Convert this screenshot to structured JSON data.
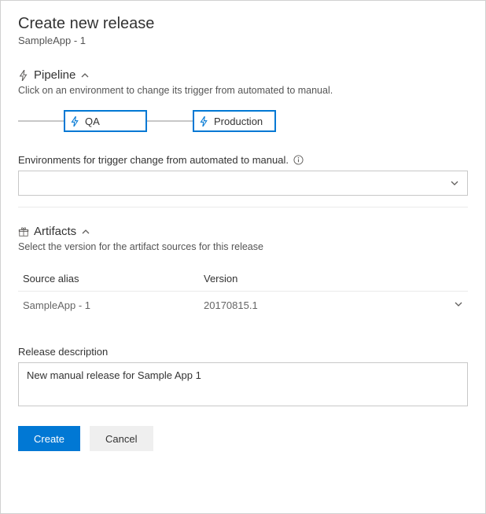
{
  "header": {
    "title": "Create new release",
    "subtitle": "SampleApp - 1"
  },
  "pipeline": {
    "label": "Pipeline",
    "description": "Click on an environment to change its trigger from automated to manual.",
    "stages": [
      {
        "name": "QA"
      },
      {
        "name": "Production"
      }
    ]
  },
  "environments": {
    "label": "Environments for trigger change from automated to manual.",
    "selected": ""
  },
  "artifacts": {
    "label": "Artifacts",
    "description": "Select the version for the artifact sources for this release",
    "columns": {
      "alias": "Source alias",
      "version": "Version"
    },
    "rows": [
      {
        "alias": "SampleApp - 1",
        "version": "20170815.1"
      }
    ]
  },
  "description": {
    "label": "Release description",
    "value": "New manual release for Sample App 1"
  },
  "buttons": {
    "create": "Create",
    "cancel": "Cancel"
  }
}
